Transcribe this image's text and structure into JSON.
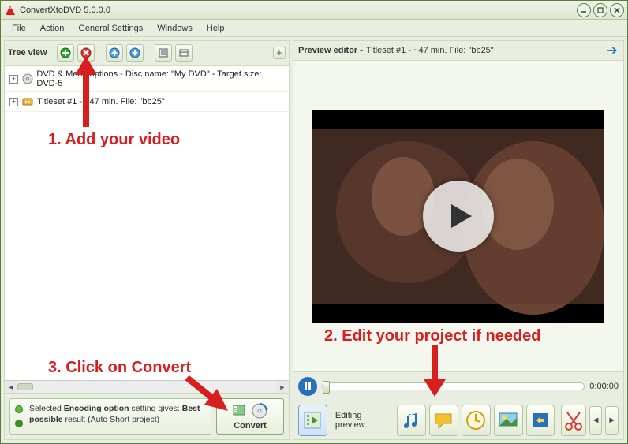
{
  "window": {
    "title": "ConvertXtoDVD 5.0.0.0"
  },
  "menu": {
    "file": "File",
    "action": "Action",
    "general_settings": "General Settings",
    "windows": "Windows",
    "help": "Help"
  },
  "left": {
    "section_label": "Tree view",
    "tree_rows": [
      {
        "text": "DVD & Menu options - Disc name: \"My DVD\" - Target size: DVD-5"
      },
      {
        "text": "Titleset #1 - ~47 min. File: \"bb25\""
      }
    ],
    "status_html_parts": {
      "pre": "Selected ",
      "bold1": "Encoding option",
      "mid": " setting gives: ",
      "bold2": "Best possible",
      "post": " result (Auto Short project)"
    },
    "convert_label": "Convert"
  },
  "right": {
    "header_label": "Preview editor -",
    "header_file": "Titleset #1 - ~47 min. File: \"bb25\"",
    "time": "0:00:00",
    "editing_tab_label": "Editing preview"
  },
  "annotations": {
    "a1": "1. Add your video",
    "a2": "2. Edit your project if needed",
    "a3": "3. Click on Convert"
  }
}
